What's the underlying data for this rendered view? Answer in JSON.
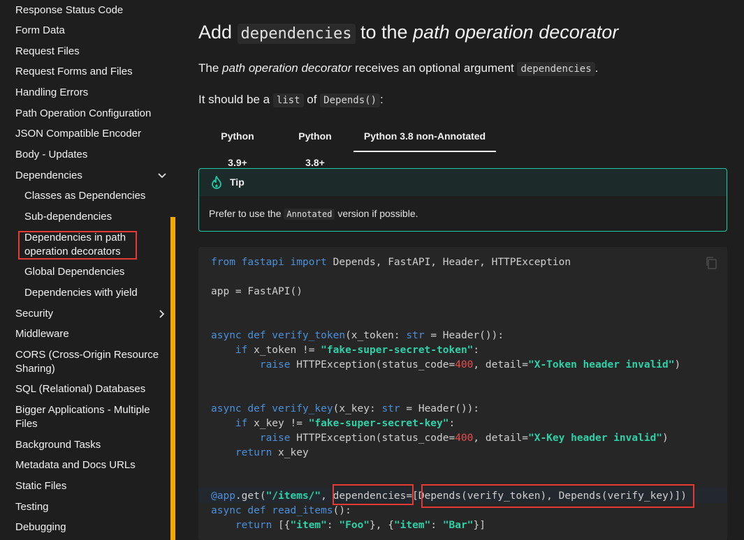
{
  "sidebar": {
    "items": [
      {
        "label": "Response Status Code"
      },
      {
        "label": "Form Data"
      },
      {
        "label": "Request Files"
      },
      {
        "label": "Request Forms and Files"
      },
      {
        "label": "Handling Errors"
      },
      {
        "label": "Path Operation Configuration"
      },
      {
        "label": "JSON Compatible Encoder"
      },
      {
        "label": "Body - Updates"
      },
      {
        "label": "Dependencies"
      },
      {
        "label": "Classes as Dependencies"
      },
      {
        "label": "Sub-dependencies"
      },
      {
        "label": "Dependencies in path operation decorators"
      },
      {
        "label": "Global Dependencies"
      },
      {
        "label": "Dependencies with yield"
      },
      {
        "label": "Security"
      },
      {
        "label": "Middleware"
      },
      {
        "label": "CORS (Cross-Origin Resource Sharing)"
      },
      {
        "label": "SQL (Relational) Databases"
      },
      {
        "label": "Bigger Applications - Multiple Files"
      },
      {
        "label": "Background Tasks"
      },
      {
        "label": "Metadata and Docs URLs"
      },
      {
        "label": "Static Files"
      },
      {
        "label": "Testing"
      },
      {
        "label": "Debugging"
      }
    ],
    "accent_color": "#f5a800"
  },
  "main": {
    "heading": {
      "pre": "Add ",
      "code": "dependencies",
      "mid": " to the ",
      "em": "path operation decorator"
    },
    "para1": {
      "pre": "The ",
      "em": "path operation decorator",
      "mid": " receives an optional argument ",
      "code": "dependencies",
      "post": "."
    },
    "para2": {
      "pre": "It should be a ",
      "code1": "list",
      "mid": " of ",
      "code2": "Depends()",
      "post": ":"
    },
    "tabs": [
      {
        "label": "Python 3.9+"
      },
      {
        "label": "Python 3.8+"
      },
      {
        "label": "Python 3.8 non-Annotated"
      }
    ],
    "tip": {
      "title": "Tip",
      "body_pre": "Prefer to use the ",
      "body_code": "Annotated",
      "body_post": " version if possible.",
      "color": "#1ec8a5"
    },
    "code": {
      "l1": [
        "from",
        " fastapi ",
        "import",
        " Depends, FastAPI, Header, HTTPException"
      ],
      "l2": "app = FastAPI()",
      "l3": [
        "async def",
        " verify_token",
        "(x_token: ",
        "str",
        " = Header()):"
      ],
      "l4": [
        "    ",
        "if",
        " x_token != ",
        "\"fake-super-secret-token\"",
        ":"
      ],
      "l5": [
        "        ",
        "raise",
        " HTTPException(status_code=",
        "400",
        ", detail=",
        "\"X-Token header invalid\"",
        ")"
      ],
      "l6": [
        "async def",
        " verify_key",
        "(x_key: ",
        "str",
        " = Header()):"
      ],
      "l7": [
        "    ",
        "if",
        " x_key != ",
        "\"fake-super-secret-key\"",
        ":"
      ],
      "l8": [
        "        ",
        "raise",
        " HTTPException(status_code=",
        "400",
        ", detail=",
        "\"X-Key header invalid\"",
        ")"
      ],
      "l9": [
        "    ",
        "return",
        " x_key"
      ],
      "l10": [
        "@app",
        ".get(",
        "\"/items/\"",
        ", ",
        "dependencies",
        "=[",
        "Depends(verify_token), Depends(verify_key)",
        "])"
      ],
      "l11": [
        "async def",
        " read_items",
        "():"
      ],
      "l12": [
        "    ",
        "return",
        " [{",
        "\"item\"",
        ": ",
        "\"Foo\"",
        "}, {",
        "\"item\"",
        ": ",
        "\"Bar\"",
        "}]"
      ]
    }
  }
}
